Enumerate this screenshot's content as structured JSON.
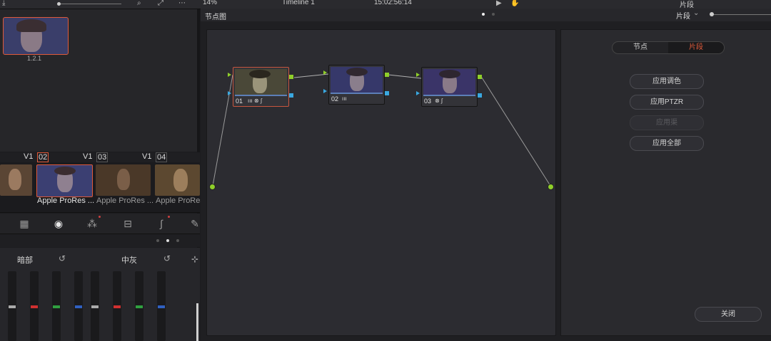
{
  "topbar": {
    "zoom": "14%",
    "timeline": "Timeline 1",
    "timecode": "15:02:56:14",
    "clip_mode": "片段",
    "icons": [
      "import-icon",
      "search-icon",
      "expand-icon",
      "more-icon",
      "play-icon",
      "hand-icon",
      "chevron-down-icon"
    ]
  },
  "media": {
    "thumbnail_label": "1.2.1"
  },
  "clips": {
    "track_labels": [
      "V1",
      "V1",
      "V1"
    ],
    "items": [
      {
        "number": "",
        "label": ""
      },
      {
        "number": "02",
        "label": "Apple ProRes ..."
      },
      {
        "number": "03",
        "label": "Apple ProRes ..."
      },
      {
        "number": "04",
        "label": "Apple ProRes ..."
      }
    ]
  },
  "sliders": {
    "shadows_label": "暗部",
    "midtones_label": "中灰"
  },
  "node_panel": {
    "title": "节点图",
    "mode_label": "片段",
    "nodes": [
      {
        "id": "01",
        "label": "01"
      },
      {
        "id": "02",
        "label": "02"
      },
      {
        "id": "03",
        "label": "03"
      }
    ]
  },
  "side_panel": {
    "tab_node": "节点",
    "tab_clip": "片段",
    "btn_apply_grade": "应用调色",
    "btn_apply_ptzr": "应用PTZR",
    "btn_apply_lut": "应用渠",
    "btn_apply_all": "应用全部",
    "btn_close": "关闭"
  },
  "colors": {
    "accent_red": "#e05a3a",
    "port_green": "#8fcf2a",
    "port_blue": "#3aa8e0",
    "selection": "#c7563e"
  }
}
